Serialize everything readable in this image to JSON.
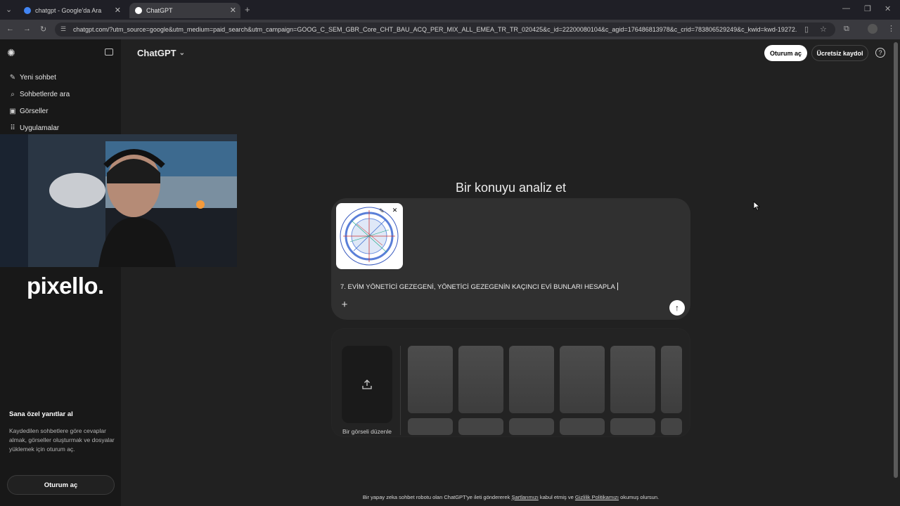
{
  "browser": {
    "tabs": [
      {
        "title": "chatgpt - Google'da Ara",
        "favicon_color": "#4285f4"
      },
      {
        "title": "ChatGPT",
        "favicon_color": "#ffffff"
      }
    ],
    "url": "chatgpt.com/?utm_source=google&utm_medium=paid_search&utm_campaign=GOOG_C_SEM_GBR_Core_CHT_BAU_ACQ_PER_MIX_ALL_EMEA_TR_TR_020425&c_id=22200080104&c_agid=176486813978&c_crid=783806529249&c_kwid=kwd-19272..."
  },
  "sidebar": {
    "items": [
      {
        "label": "Yeni sohbet",
        "icon": "edit-icon"
      },
      {
        "label": "Sohbetlerde ara",
        "icon": "search-icon"
      },
      {
        "label": "Görseller",
        "icon": "image-icon"
      },
      {
        "label": "Uygulamalar",
        "icon": "apps-icon"
      }
    ],
    "watermark": "pixello.",
    "promo_title": "Sana özel yanıtlar al",
    "promo_text": "Kaydedilen sohbetlere göre cevaplar almak, görseller oluşturmak ve dosyalar yüklemek için oturum aç.",
    "login_label": "Oturum aç"
  },
  "header": {
    "model": "ChatGPT",
    "login_label": "Oturum aç",
    "signup_label": "Ücretsiz kaydol",
    "help_symbol": "?"
  },
  "main": {
    "headline": "Bir konuyu analiz et",
    "prompt_text": "7. EVİM YÖNETİCİ GEZEGENİ, YÖNETİCİ GEZEGENİN KAÇINCI EVİ BUNLARI HESAPLA",
    "gallery_upload_label": "Bir görseli düzenle"
  },
  "footer": {
    "prefix": "Bir yapay zeka sohbet robotu olan ChatGPT'ye ileti göndererek ",
    "terms": "Şartlarımızı",
    "middle": " kabul etmiş ve ",
    "privacy": "Gizlilik Politikamızı",
    "suffix": " okumuş olursun."
  },
  "colors": {
    "background": "#212121",
    "sidebar": "#181818",
    "composer": "#303030",
    "accent_white": "#ffffff"
  }
}
